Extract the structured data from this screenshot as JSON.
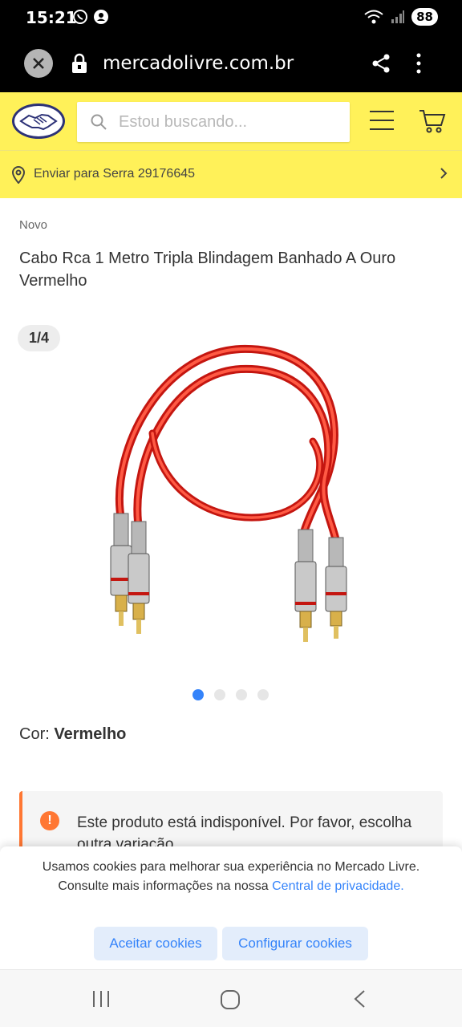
{
  "status_bar": {
    "time": "15:21",
    "battery": "88"
  },
  "browser": {
    "url": "mercadolivre.com.br"
  },
  "header": {
    "search_placeholder": "Estou buscando...",
    "location": "Enviar para Serra 29176645"
  },
  "product": {
    "condition": "Novo",
    "title": "Cabo Rca 1 Metro Tripla Blindagem Banhado A Ouro Vermelho",
    "gallery_counter": "1/4",
    "gallery_total": 4,
    "gallery_active": 1,
    "color_label": "Cor:",
    "color_value": "Vermelho",
    "notice": "Este produto está indisponível. Por favor, escolha outra variação."
  },
  "cookies": {
    "text": "Usamos cookies para melhorar sua experiência no Mercado Livre. Consulte mais informações na nossa",
    "link": "Central de privacidade.",
    "accept": "Aceitar cookies",
    "configure": "Configurar cookies"
  },
  "colors": {
    "brand_yellow": "#fff159",
    "accent_blue": "#3483fa",
    "notice_orange": "#ff7733"
  }
}
